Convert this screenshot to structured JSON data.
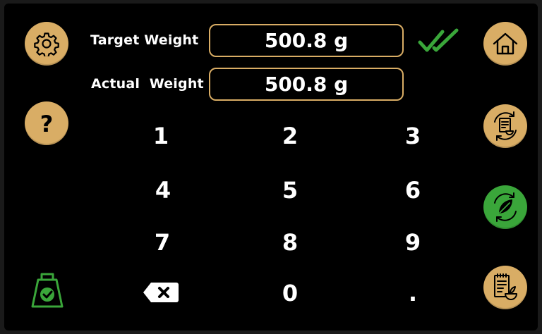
{
  "form": {
    "target_label": "Target Weight",
    "target_value": "500.8 g",
    "actual_label": "Actual  Weight",
    "actual_value": "500.8 g"
  },
  "keypad": {
    "keys": [
      "1",
      "2",
      "3",
      "4",
      "5",
      "6",
      "7",
      "8",
      "9",
      "0",
      "."
    ]
  },
  "icons": {
    "settings": "gear-icon",
    "help": "question-icon",
    "scale": "scale-check-icon",
    "backspace": "backspace-icon",
    "confirm": "double-check-icon",
    "home": "home-icon",
    "recipe_sync": "recipe-sync-icon",
    "leaf_sync": "leaf-sync-icon",
    "recipe": "recipe-icon"
  },
  "colors": {
    "accent_gold": "#d9ad65",
    "accent_green": "#3aa63a",
    "background": "#000000",
    "text": "#ffffff"
  }
}
